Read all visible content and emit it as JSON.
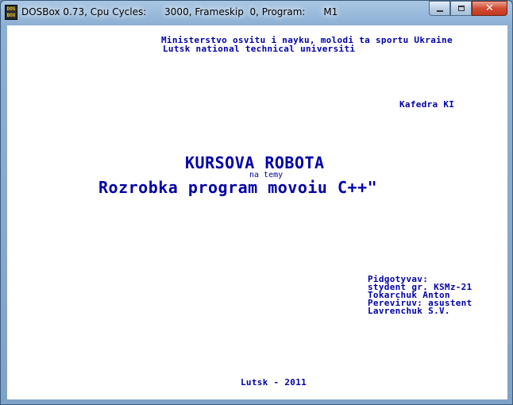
{
  "window": {
    "title": "DOSBox 0.73, Cpu Cycles:      3000, Frameskip  0, Program:      M1",
    "icon_text": "DOS BOX"
  },
  "screen": {
    "header_line1": "Ministerstvo osvitu i nayku, molodi ta sportu Ukraine",
    "header_line2": "Lutsk national technical universiti",
    "department": "Kafedra KI",
    "title": "KURSOVA ROBOTA",
    "subtitle_prefix": "na temy",
    "topic": "Rozrobka program movoiu C++\"",
    "prepared_label": "Pidgotyvav:",
    "student_group": "stydent gr. KSMz-21",
    "student_name": "Tokarchuk Anton",
    "checked_label": "Pereviruv: asustent",
    "teacher_name": "Lavrenchuk S.V.",
    "footer": "Lutsk - 2011"
  },
  "icons": {
    "minimize": "minimize-icon",
    "maximize": "maximize-icon",
    "close": "close-icon"
  },
  "colors": {
    "text": "#0000a8",
    "background": "#ffffff",
    "close_button": "#c23a22"
  }
}
